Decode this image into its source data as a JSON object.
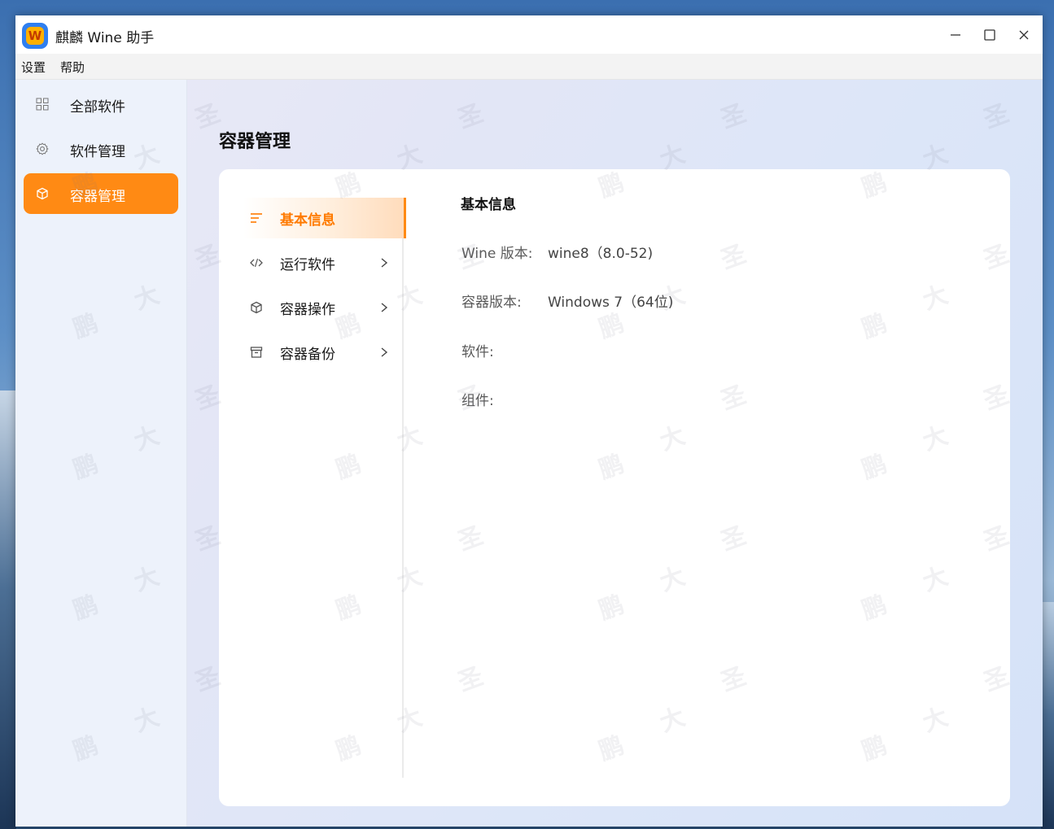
{
  "window": {
    "title": "麒麟 Wine 助手",
    "logo_glyph": "W",
    "accent_color": "#ff8a14"
  },
  "menubar": {
    "items": [
      {
        "label": "设置"
      },
      {
        "label": "帮助"
      }
    ]
  },
  "sidebar": {
    "items": [
      {
        "label": "全部软件",
        "icon": "grid-icon",
        "active": false
      },
      {
        "label": "软件管理",
        "icon": "gear-icon",
        "active": false
      },
      {
        "label": "容器管理",
        "icon": "cube-icon",
        "active": true
      }
    ]
  },
  "page": {
    "title": "容器管理"
  },
  "subnav": {
    "items": [
      {
        "label": "基本信息",
        "icon": "list-lines-icon",
        "active": true
      },
      {
        "label": "运行软件",
        "icon": "code-icon",
        "active": false
      },
      {
        "label": "容器操作",
        "icon": "cube-icon",
        "active": false
      },
      {
        "label": "容器备份",
        "icon": "archive-icon",
        "active": false
      }
    ]
  },
  "info": {
    "heading": "基本信息",
    "wine_version_label": "Wine 版本:",
    "wine_version_value": "wine8（8.0-52)",
    "container_version_label": "容器版本:",
    "container_version_value": "Windows 7（64位)",
    "software_label": "软件:",
    "components_label": "组件:"
  },
  "watermark": {
    "chars": [
      "圣",
      "大",
      "鹏"
    ]
  }
}
